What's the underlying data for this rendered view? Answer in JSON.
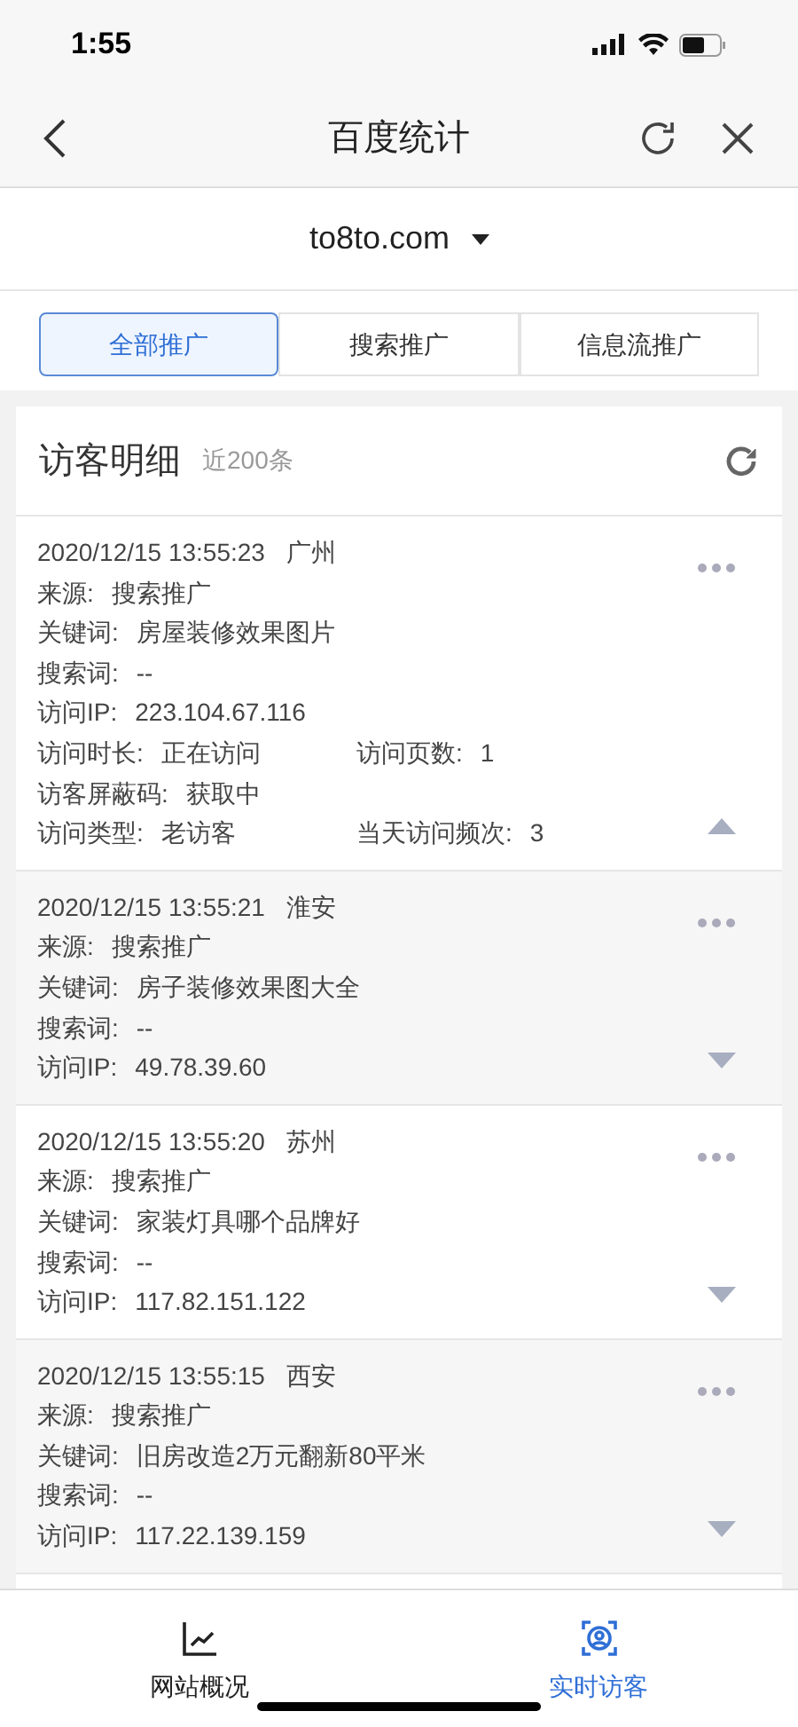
{
  "status_bar": {
    "time": "1:55"
  },
  "nav": {
    "title": "百度统计"
  },
  "site": {
    "domain": "to8to.com"
  },
  "tabs": [
    {
      "label": "全部推广",
      "selected": true
    },
    {
      "label": "搜索推广",
      "selected": false
    },
    {
      "label": "信息流推广",
      "selected": false
    }
  ],
  "panel": {
    "title": "访客明细",
    "count": "近200条"
  },
  "visitors": [
    {
      "time": "2020/12/15 13:55:23",
      "city": "广州",
      "expanded": true,
      "rows": [
        [
          {
            "label": "来源:",
            "value": "搜索推广"
          }
        ],
        [
          {
            "label": "关键词:",
            "value": "房屋装修效果图片"
          }
        ],
        [
          {
            "label": "搜索词:",
            "value": "--"
          }
        ],
        [
          {
            "label": "访问IP:",
            "value": "223.104.67.116"
          }
        ],
        [
          {
            "label": "访问时长:",
            "value": "正在访问"
          },
          {
            "label": "访问页数:",
            "value": "1"
          }
        ],
        [
          {
            "label": "访客屏蔽码:",
            "value": "获取中"
          }
        ],
        [
          {
            "label": "访问类型:",
            "value": "老访客"
          },
          {
            "label": "当天访问频次:",
            "value": "3"
          }
        ]
      ]
    },
    {
      "time": "2020/12/15 13:55:21",
      "city": "淮安",
      "expanded": false,
      "rows": [
        [
          {
            "label": "来源:",
            "value": "搜索推广"
          }
        ],
        [
          {
            "label": "关键词:",
            "value": "房子装修效果图大全"
          }
        ],
        [
          {
            "label": "搜索词:",
            "value": "--"
          }
        ],
        [
          {
            "label": "访问IP:",
            "value": "49.78.39.60"
          }
        ]
      ]
    },
    {
      "time": "2020/12/15 13:55:20",
      "city": "苏州",
      "expanded": false,
      "rows": [
        [
          {
            "label": "来源:",
            "value": "搜索推广"
          }
        ],
        [
          {
            "label": "关键词:",
            "value": "家装灯具哪个品牌好"
          }
        ],
        [
          {
            "label": "搜索词:",
            "value": "--"
          }
        ],
        [
          {
            "label": "访问IP:",
            "value": "117.82.151.122"
          }
        ]
      ]
    },
    {
      "time": "2020/12/15 13:55:15",
      "city": "西安",
      "expanded": false,
      "rows": [
        [
          {
            "label": "来源:",
            "value": "搜索推广"
          }
        ],
        [
          {
            "label": "关键词:",
            "value": "旧房改造2万元翻新80平米"
          }
        ],
        [
          {
            "label": "搜索词:",
            "value": "--"
          }
        ],
        [
          {
            "label": "访问IP:",
            "value": "117.22.139.159"
          }
        ]
      ]
    }
  ],
  "bottom_tabs": [
    {
      "kind": "overview",
      "label": "网站概况",
      "selected": false
    },
    {
      "kind": "visitors",
      "label": "实时访客",
      "selected": true
    }
  ]
}
